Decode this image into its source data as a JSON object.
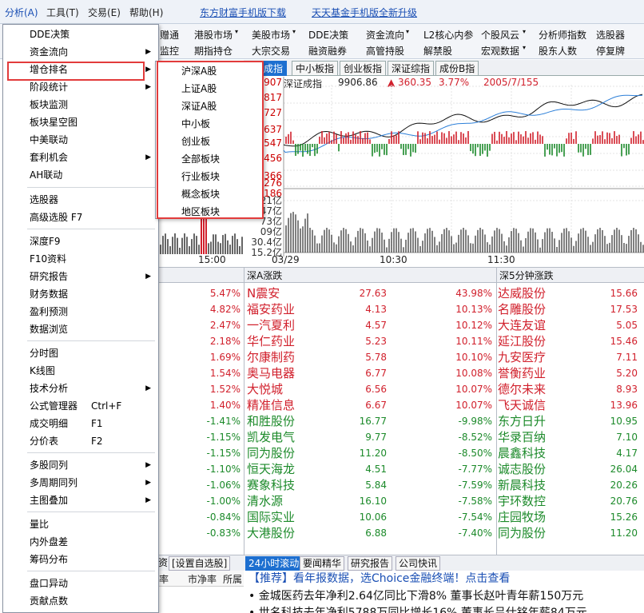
{
  "menubar": {
    "items": [
      "分析(A)",
      "工具(T)",
      "交易(E)",
      "帮助(H)"
    ],
    "links": [
      "东方财富手机版下载",
      "天天基金手机版全新升级"
    ]
  },
  "nav": {
    "row1": [
      "港股市场",
      "美股市场",
      "DDE决策",
      "资金流向",
      "L2核心内参",
      "个股风云",
      "分析师指数",
      "选股器"
    ],
    "row2": [
      "期指持仓",
      "大宗交易",
      "融资融券",
      "高管持股",
      "解禁股",
      "宏观数据",
      "股东人数",
      "停复牌"
    ],
    "partial_row1": "赠通",
    "partial_row2": "监控"
  },
  "index_tabs": [
    "成指",
    "中小板指",
    "创业板指",
    "深证综指",
    "成份B指"
  ],
  "index_info": {
    "name": "深证成指",
    "value": "9906.86",
    "change": "▲ 360.35",
    "pct": "3.77%",
    "updown": "2005/7/155"
  },
  "chart_data": {
    "type": "line",
    "price_ticks": [
      "907",
      "817",
      "727",
      "637",
      "547",
      "456",
      "366",
      "276",
      "186"
    ],
    "volume_ticks": [
      "21亿",
      "47亿",
      "73亿",
      "09亿",
      "30.4亿",
      "15.2亿"
    ],
    "x_ticks": [
      "03/29",
      "10:30",
      "11:30"
    ],
    "left_x_tick": "15:00"
  },
  "tables": {
    "headers": [
      "深A涨跌",
      "深5分钟涨跌"
    ],
    "left_pcts": [
      "5.47%",
      "4.82%",
      "2.47%",
      "2.18%",
      "1.69%",
      "1.54%",
      "1.52%",
      "1.40%",
      "-1.41%",
      "-1.15%",
      "-1.15%",
      "-1.10%",
      "-1.06%",
      "-1.00%",
      "-0.84%",
      "-0.83%"
    ],
    "mid": [
      {
        "name": "N震安",
        "price": "27.63",
        "pct": "43.98%"
      },
      {
        "name": "福安药业",
        "price": "4.13",
        "pct": "10.13%"
      },
      {
        "name": "一汽夏利",
        "price": "4.57",
        "pct": "10.12%"
      },
      {
        "name": "华仁药业",
        "price": "5.23",
        "pct": "10.11%"
      },
      {
        "name": "尔康制药",
        "price": "5.78",
        "pct": "10.10%"
      },
      {
        "name": "奥马电器",
        "price": "6.77",
        "pct": "10.08%"
      },
      {
        "name": "大悦城",
        "price": "6.56",
        "pct": "10.07%"
      },
      {
        "name": "精准信息",
        "price": "6.67",
        "pct": "10.07%"
      },
      {
        "name": "和胜股份",
        "price": "16.77",
        "pct": "-9.98%"
      },
      {
        "name": "凯发电气",
        "price": "9.77",
        "pct": "-8.52%"
      },
      {
        "name": "同为股份",
        "price": "11.20",
        "pct": "-8.50%"
      },
      {
        "name": "恒天海龙",
        "price": "4.51",
        "pct": "-7.77%"
      },
      {
        "name": "赛象科技",
        "price": "5.84",
        "pct": "-7.59%"
      },
      {
        "name": "清水源",
        "price": "16.10",
        "pct": "-7.58%"
      },
      {
        "name": "国际实业",
        "price": "10.06",
        "pct": "-7.54%"
      },
      {
        "name": "大港股份",
        "price": "6.88",
        "pct": "-7.40%"
      }
    ],
    "right": [
      {
        "name": "达威股份",
        "price": "15.66"
      },
      {
        "name": "名雕股份",
        "price": "17.53"
      },
      {
        "name": "大连友谊",
        "price": "5.05"
      },
      {
        "name": "延江股份",
        "price": "15.46"
      },
      {
        "name": "九安医疗",
        "price": "7.11"
      },
      {
        "name": "誉衡药业",
        "price": "5.20"
      },
      {
        "name": "德尔未来",
        "price": "8.93"
      },
      {
        "name": "飞天诚信",
        "price": "13.96"
      },
      {
        "name": "东方日升",
        "price": "10.95"
      },
      {
        "name": "华录百纳",
        "price": "7.10"
      },
      {
        "name": "晨鑫科技",
        "price": "4.17"
      },
      {
        "name": "诚志股份",
        "price": "26.04"
      },
      {
        "name": "新晨科技",
        "price": "20.26"
      },
      {
        "name": "宇环数控",
        "price": "20.76"
      },
      {
        "name": "庄园牧场",
        "price": "15.26"
      },
      {
        "name": "同为股份",
        "price": "11.20"
      }
    ]
  },
  "bottom": {
    "left_tabs": [
      "[设置自选股]",
      "资"
    ],
    "tabs": [
      "24小时滚动",
      "要闻精华",
      "研究报告",
      "公司快讯"
    ],
    "cols": [
      "率",
      "市净率",
      "所属"
    ],
    "promo": "【推荐】看年报数据，选Choice金融终端！点击查看",
    "news": [
      "金城医药去年净利2.64亿同比下滑8% 董事长赵叶青年薪150万元",
      "世名科技去年净利5788万同比增长16% 董事长吕仕铭年薪84万元"
    ]
  },
  "menu": {
    "items": [
      {
        "label": "DDE决策"
      },
      {
        "label": "资金流向",
        "submenu": true
      },
      {
        "label": "增仓排名",
        "submenu": true,
        "active": true
      },
      {
        "label": "阶段统计",
        "submenu": true
      },
      {
        "label": "板块监测"
      },
      {
        "label": "板块星空图"
      },
      {
        "label": "中美联动"
      },
      {
        "label": "套利机会",
        "submenu": true
      },
      {
        "label": "AH联动"
      },
      {
        "label": "选股器",
        "sep_before": true
      },
      {
        "label": "高级选股 F7"
      },
      {
        "label": "深度F9",
        "sep_before": true
      },
      {
        "label": "F10资料"
      },
      {
        "label": "研究报告",
        "submenu": true
      },
      {
        "label": "财务数据"
      },
      {
        "label": "盈利预测"
      },
      {
        "label": "数据浏览"
      },
      {
        "label": "分时图",
        "sep_before": true
      },
      {
        "label": "K线图"
      },
      {
        "label": "技术分析",
        "submenu": true
      },
      {
        "label": "公式管理器",
        "shortcut": "Ctrl+F"
      },
      {
        "label": "成交明细",
        "shortcut": "F1"
      },
      {
        "label": "分价表",
        "shortcut": "F2"
      },
      {
        "label": "多股同列",
        "submenu": true,
        "sep_before": true
      },
      {
        "label": "多周期同列",
        "submenu": true
      },
      {
        "label": "主图叠加",
        "submenu": true
      },
      {
        "label": "量比",
        "sep_before": true
      },
      {
        "label": "内外盘差"
      },
      {
        "label": "筹码分布"
      },
      {
        "label": "盘口异动",
        "sep_before": true
      },
      {
        "label": "贡献点数"
      }
    ],
    "submenu_items": [
      "沪深A股",
      "上证A股",
      "深证A股",
      "中小板",
      "创业板",
      "全部板块",
      "行业板块",
      "概念板块",
      "地区板块"
    ]
  },
  "colors": {
    "up": "#d1202c",
    "down": "#1c8a2a",
    "highlight_box": "#e23b3b",
    "tab_active": "#1d6fd0"
  }
}
